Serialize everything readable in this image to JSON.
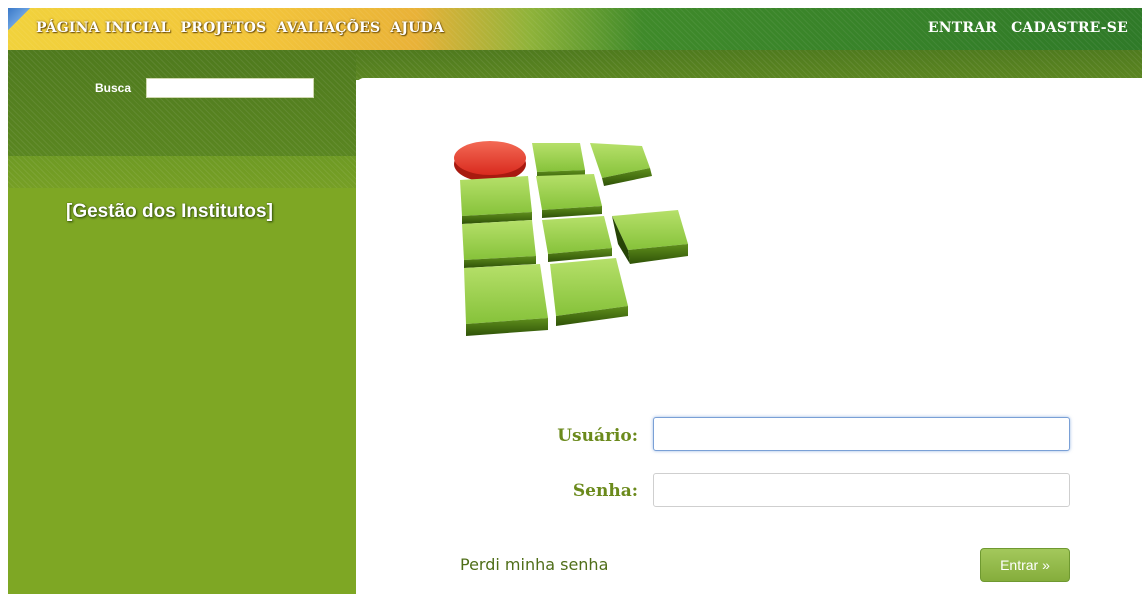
{
  "nav": {
    "left": [
      "PÁGINA INICIAL",
      "PROJETOS",
      "AVALIAÇÕES",
      "AJUDA"
    ],
    "right": [
      "ENTRAR",
      "CADASTRE-SE"
    ]
  },
  "sidebar": {
    "search_label": "Busca",
    "search_value": "",
    "title": "[Gestão dos Institutos]"
  },
  "login": {
    "user_label": "Usuário:",
    "user_value": "",
    "pass_label": "Senha:",
    "pass_value": "",
    "forgot_label": "Perdi minha senha",
    "submit_label": "Entrar »"
  },
  "colors": {
    "accent_green": "#7ea724",
    "label_green": "#6b8a1c",
    "logo_red": "#e43a2a",
    "logo_green": "#8cc63e"
  },
  "icons": {
    "logo": "institute-logo-icon"
  }
}
